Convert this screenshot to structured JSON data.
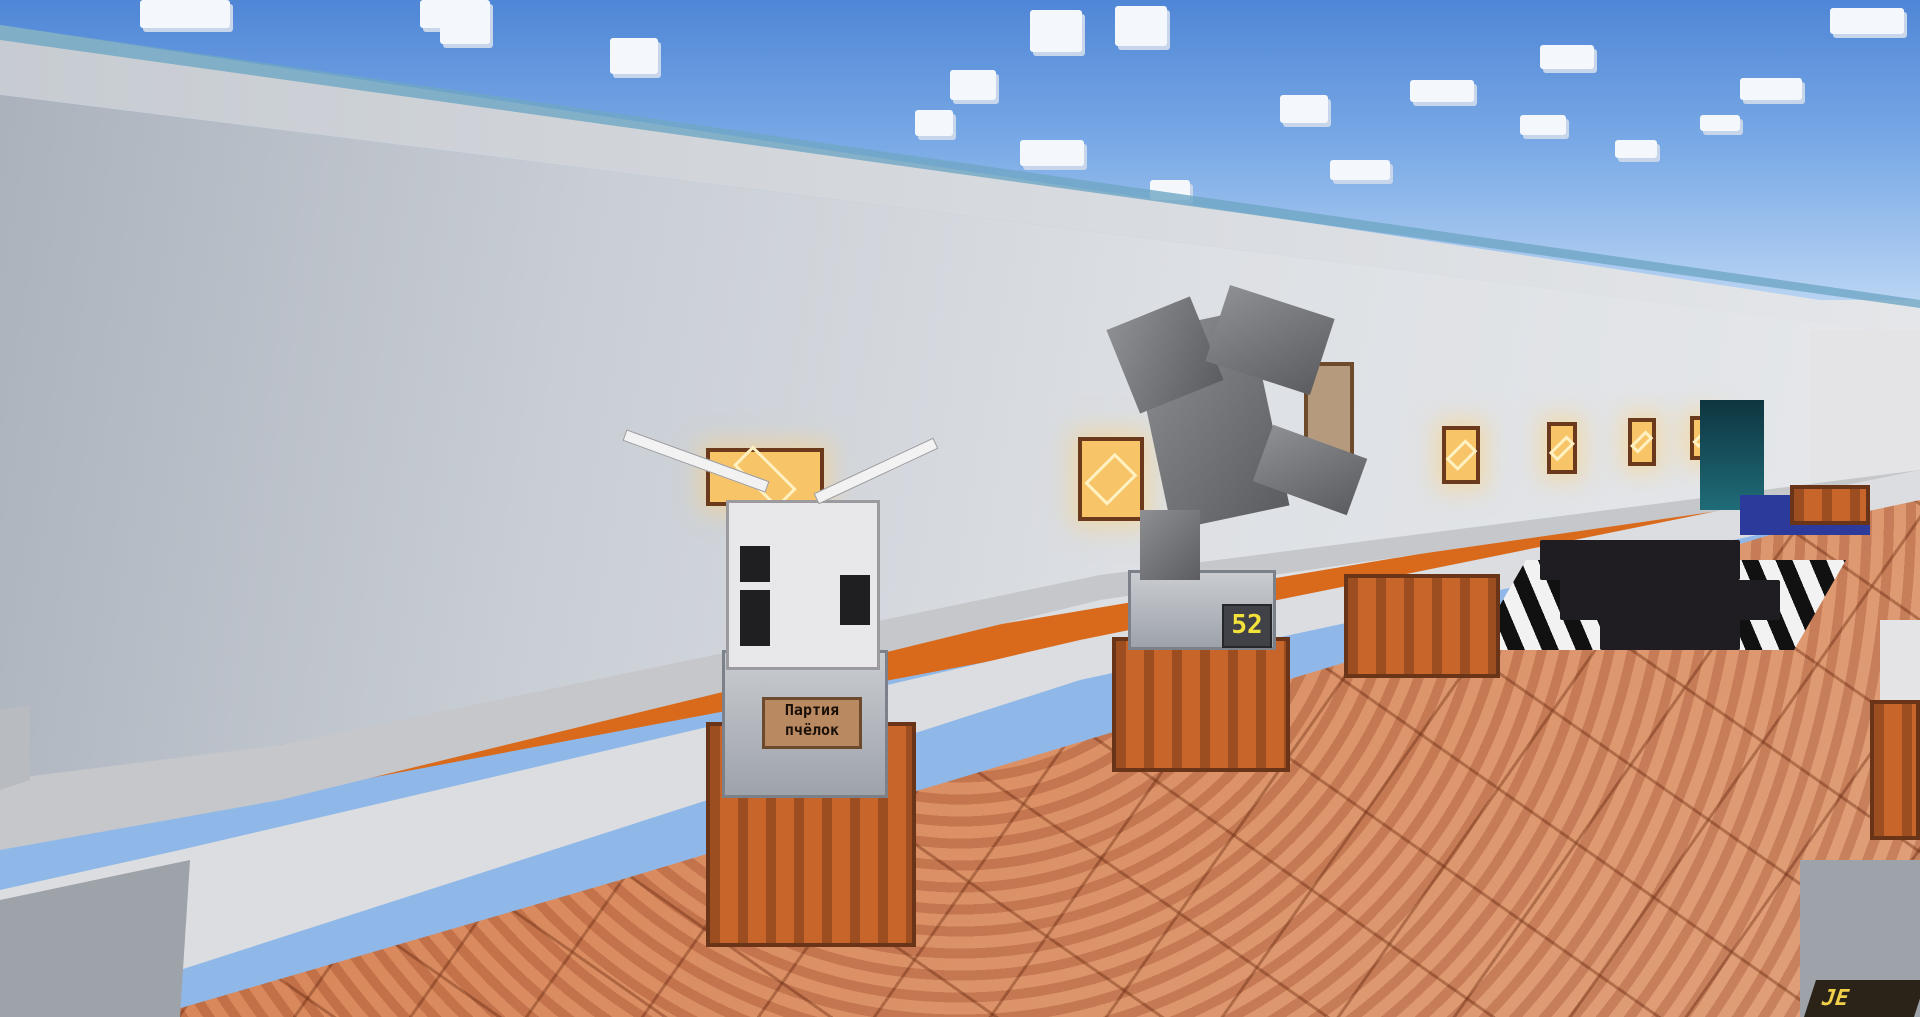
{
  "scene": {
    "sign_line_1": "Партия",
    "sign_line_2": "пчёлок",
    "statue_number": "52",
    "corner_plate_text": "JE"
  },
  "colors": {
    "sky": "#7aaae6",
    "wall": "#dde0e4",
    "trim": "#d96a1c",
    "floor": "#d8875a",
    "lamp": "#f7c468",
    "number_text": "#f3e23a"
  }
}
